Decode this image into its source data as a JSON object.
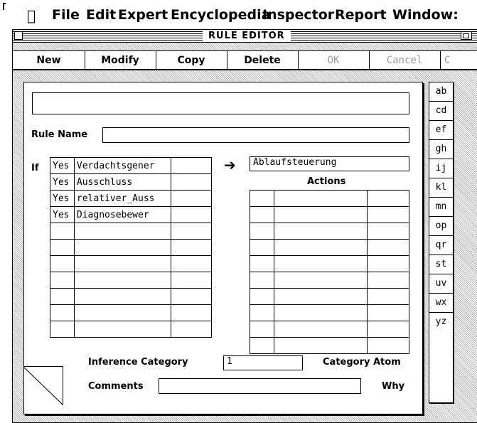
{
  "menubar": {
    "items": [
      "File",
      "Edit",
      "Expert",
      "Encyclopedia",
      "Inspector",
      "Report",
      "Window:"
    ]
  },
  "window": {
    "title": "RULE EDITOR"
  },
  "toolbar": {
    "buttons": [
      "New",
      "Modify",
      "Copy",
      "Delete",
      "OK",
      "Cancel",
      "C"
    ]
  },
  "form": {
    "top_field_value": "",
    "rule_name_label": "Rule Name",
    "rule_name_value": "",
    "if_label": "If",
    "conditions": [
      {
        "status": "Yes",
        "name": "Verdachtsgener",
        "extra": ""
      },
      {
        "status": "Yes",
        "name": "Ausschluss",
        "extra": ""
      },
      {
        "status": "Yes",
        "name": "relativer_Auss",
        "extra": ""
      },
      {
        "status": "Yes",
        "name": "Diagnosebewer",
        "extra": ""
      },
      {
        "status": "",
        "name": "",
        "extra": ""
      },
      {
        "status": "",
        "name": "",
        "extra": ""
      },
      {
        "status": "",
        "name": "",
        "extra": ""
      },
      {
        "status": "",
        "name": "",
        "extra": ""
      },
      {
        "status": "",
        "name": "",
        "extra": ""
      },
      {
        "status": "",
        "name": "",
        "extra": ""
      },
      {
        "status": "",
        "name": "",
        "extra": ""
      }
    ],
    "hypothesis_value": "Ablaufsteuerung",
    "actions_label": "Actions",
    "action_rows": 10,
    "inference_category_label": "Inference Category",
    "inference_category_value": "1",
    "category_atom_label": "Category Atom",
    "comments_label": "Comments",
    "comments_value": "",
    "why_label": "Why"
  },
  "alphabet_index": [
    "ab",
    "cd",
    "ef",
    "gh",
    "ij",
    "kl",
    "mn",
    "op",
    "qr",
    "st",
    "uv",
    "wx",
    "yz"
  ]
}
